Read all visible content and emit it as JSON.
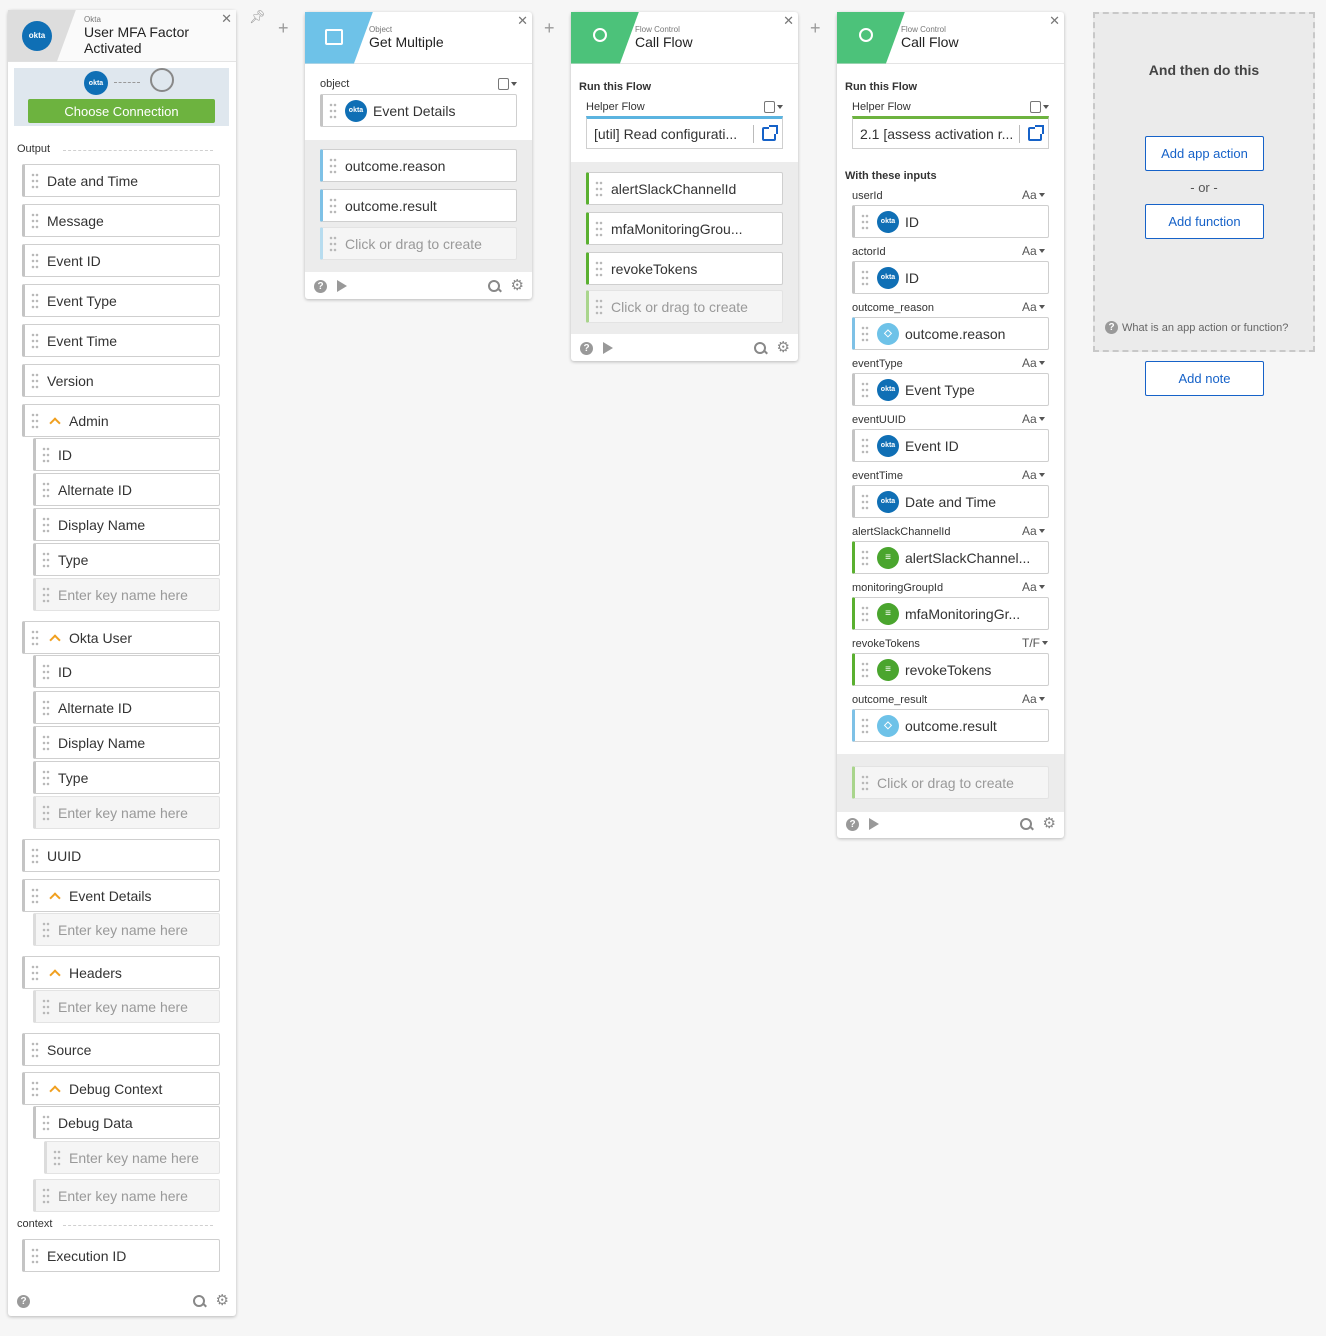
{
  "colors": {
    "okta_blue": "#0f6fb5",
    "object_blue": "#6ec2e8",
    "flow_green": "#4cc27a",
    "choose_green": "#6db33f",
    "action_blue": "#1662c8"
  },
  "event_card": {
    "category": "Okta",
    "title": "User MFA Factor Activated",
    "connection_button": "Choose Connection",
    "badge_label": "okta",
    "output_label": "Output",
    "context_label": "context",
    "fields": {
      "date_time": "Date and Time",
      "message": "Message",
      "event_id": "Event ID",
      "event_type": "Event Type",
      "event_time": "Event Time",
      "version": "Version",
      "admin": "Admin",
      "admin_id": "ID",
      "admin_alt_id": "Alternate ID",
      "admin_display": "Display Name",
      "admin_type": "Type",
      "admin_key": "Enter key name here",
      "okta_user": "Okta User",
      "user_id": "ID",
      "user_alt_id": "Alternate ID",
      "user_display": "Display Name",
      "user_type": "Type",
      "user_key": "Enter key name here",
      "uuid": "UUID",
      "event_details": "Event Details",
      "details_key": "Enter key name here",
      "headers": "Headers",
      "headers_key": "Enter key name here",
      "source": "Source",
      "debug_context": "Debug Context",
      "debug_data": "Debug Data",
      "debug_data_key": "Enter key name here",
      "debug_key": "Enter key name here",
      "execution_id": "Execution ID"
    }
  },
  "object_card": {
    "category": "Object",
    "title": "Get Multiple",
    "object_label": "object",
    "object_value": "Event Details",
    "outputs": [
      "outcome.reason",
      "outcome.result"
    ],
    "create_hint": "Click or drag to create"
  },
  "callflow1": {
    "category": "Flow Control",
    "title": "Call Flow",
    "run_label": "Run this Flow",
    "helper_label": "Helper Flow",
    "helper_value": "[util] Read configurati...",
    "outputs": [
      "alertSlackChannelId",
      "mfaMonitoringGrou...",
      "revokeTokens"
    ],
    "create_hint": "Click or drag to create"
  },
  "callflow2": {
    "category": "Flow Control",
    "title": "Call Flow",
    "run_label": "Run this Flow",
    "helper_label": "Helper Flow",
    "helper_value": "2.1 [assess activation r...",
    "inputs_label": "With these inputs",
    "inputs": [
      {
        "name": "userId",
        "type": "Aa",
        "value": "ID"
      },
      {
        "name": "actorId",
        "type": "Aa",
        "value": "ID"
      },
      {
        "name": "outcome_reason",
        "type": "Aa",
        "value": "outcome.reason"
      },
      {
        "name": "eventType",
        "type": "Aa",
        "value": "Event Type"
      },
      {
        "name": "eventUUID",
        "type": "Aa",
        "value": "Event ID"
      },
      {
        "name": "eventTime",
        "type": "Aa",
        "value": "Date and Time"
      },
      {
        "name": "alertSlackChannelId",
        "type": "Aa",
        "value": "alertSlackChannel..."
      },
      {
        "name": "monitoringGroupId",
        "type": "Aa",
        "value": "mfaMonitoringGr..."
      },
      {
        "name": "revokeTokens",
        "type": "T/F",
        "value": "revokeTokens"
      },
      {
        "name": "outcome_result",
        "type": "Aa",
        "value": "outcome.result"
      }
    ],
    "create_hint": "Click or drag to create"
  },
  "next_panel": {
    "title": "And then do this",
    "add_app_action": "Add app action",
    "or": "- or -",
    "add_function": "Add function",
    "help_text": "What is an app action or function?",
    "add_note": "Add note"
  }
}
